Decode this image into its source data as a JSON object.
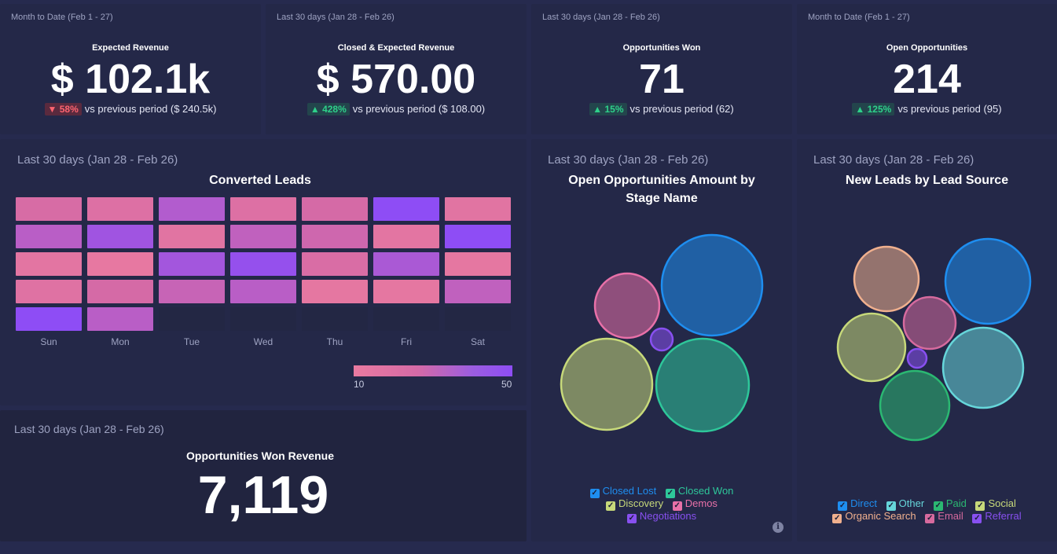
{
  "kpis": [
    {
      "period": "Month to Date (Feb 1 - 27)",
      "title": "Expected Revenue",
      "value": "$ 102.1k",
      "change": "▼ 58%",
      "direction": "down",
      "compare": "vs previous period ($ 240.5k)"
    },
    {
      "period": "Last 30 days (Jan 28 - Feb 26)",
      "title": "Closed & Expected Revenue",
      "value": "$ 570.00",
      "change": "▲ 428%",
      "direction": "up",
      "compare": "vs previous period ($ 108.00)"
    },
    {
      "period": "Last 30 days (Jan 28 - Feb 26)",
      "title": "Opportunities Won",
      "value": "71",
      "change": "▲ 15%",
      "direction": "up",
      "compare": "vs previous period (62)"
    },
    {
      "period": "Month to Date (Feb 1 - 27)",
      "title": "Open Opportunities",
      "value": "214",
      "change": "▲ 125%",
      "direction": "up",
      "compare": "vs previous period (95)"
    }
  ],
  "heatmap": {
    "period": "Last 30 days (Jan 28 - Feb 26)",
    "title": "Converted Leads",
    "days": [
      "Sun",
      "Mon",
      "Tue",
      "Wed",
      "Thu",
      "Fri",
      "Sat"
    ],
    "legend_min": "10",
    "legend_max": "50",
    "colors": {
      "low": "#e97aa0",
      "high": "#8e4df5"
    }
  },
  "chart_data": [
    {
      "type": "heatmap",
      "title": "Converted Leads",
      "x_categories": [
        "Sun",
        "Mon",
        "Tue",
        "Wed",
        "Thu",
        "Fri",
        "Sat"
      ],
      "rows": 5,
      "scale": [
        10,
        50
      ],
      "values": [
        [
          28,
          22,
          40,
          22,
          30,
          50,
          18
        ],
        [
          38,
          45,
          18,
          36,
          32,
          16,
          50
        ],
        [
          16,
          12,
          44,
          48,
          26,
          42,
          14
        ],
        [
          20,
          30,
          34,
          38,
          14,
          14,
          36
        ],
        [
          50,
          38,
          null,
          null,
          null,
          null,
          null
        ]
      ]
    },
    {
      "type": "bubble",
      "title": "Open Opportunities Amount by Stage Name",
      "series": [
        {
          "name": "Closed Lost",
          "color": "#1e8ef0",
          "r": 64
        },
        {
          "name": "Closed Won",
          "color": "#2ec79a",
          "r": 59
        },
        {
          "name": "Discovery",
          "color": "#c7d97a",
          "r": 58
        },
        {
          "name": "Demos",
          "color": "#e870a8",
          "r": 41
        },
        {
          "name": "Negotiations",
          "color": "#8850f0",
          "r": 14
        }
      ]
    },
    {
      "type": "bubble",
      "title": "New Leads by Lead Source",
      "series": [
        {
          "name": "Direct",
          "color": "#1e8ef0",
          "r": 54
        },
        {
          "name": "Other",
          "color": "#66d6da",
          "r": 51
        },
        {
          "name": "Paid",
          "color": "#2bb872",
          "r": 44
        },
        {
          "name": "Social",
          "color": "#c7d97a",
          "r": 43
        },
        {
          "name": "Organic Search",
          "color": "#f0b08e",
          "r": 41
        },
        {
          "name": "Email",
          "color": "#d66a9e",
          "r": 33
        },
        {
          "name": "Referral",
          "color": "#8850f0",
          "r": 12
        }
      ]
    }
  ],
  "won_revenue": {
    "period": "Last 30 days (Jan 28 - Feb 26)",
    "title": "Opportunities Won Revenue",
    "value": "7,119"
  },
  "stage_chart": {
    "period": "Last 30 days (Jan 28 - Feb 26)",
    "title": "Open Opportunities Amount by Stage Name",
    "legend": [
      "Closed Lost",
      "Closed Won",
      "Discovery",
      "Demos",
      "Negotiations"
    ]
  },
  "source_chart": {
    "period": "Last 30 days (Jan 28 - Feb 26)",
    "title": "New Leads by Lead Source",
    "legend": [
      "Direct",
      "Other",
      "Paid",
      "Social",
      "Organic Search",
      "Email",
      "Referral"
    ]
  },
  "icons": {
    "info": "info-icon",
    "legend_check": "checkbox-check-icon"
  },
  "info_glyph": "i",
  "check_glyph": "✓"
}
